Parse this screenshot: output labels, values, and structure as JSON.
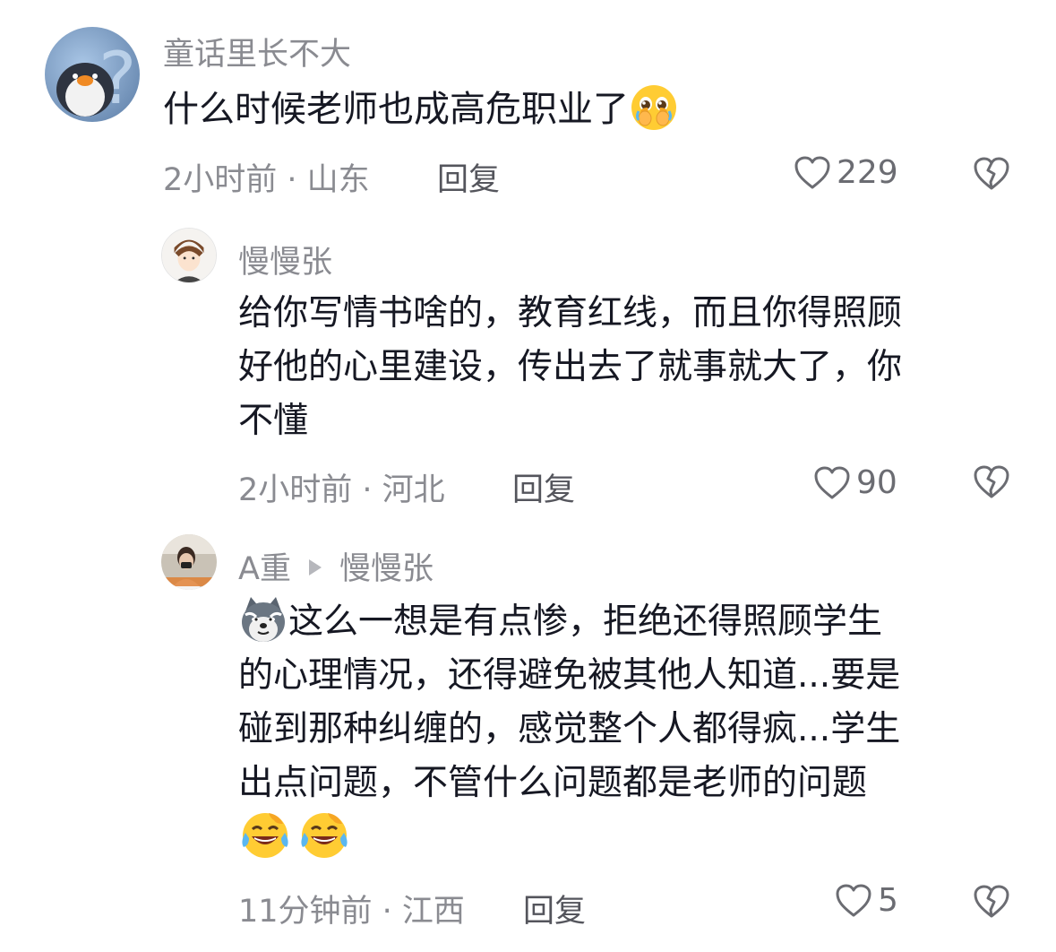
{
  "comments": [
    {
      "username": "童话里长不大",
      "text": "什么时候老师也成高危职业了",
      "emoji": "pleading-face-emoji",
      "time_location": "2小时前 · 山东",
      "reply_label": "回复",
      "likes": "229"
    },
    {
      "username": "慢慢张",
      "lines": [
        "给你写情书啥的，教育红线，而且你得照顾",
        "好他的心里建设，传出去了就事就大了，你",
        "不懂"
      ],
      "time_location": "2小时前 · 河北",
      "reply_label": "回复",
      "likes": "90"
    },
    {
      "username": "A重",
      "reply_to": "慢慢张",
      "lead_emoji": "dog-face-emoji",
      "lines": [
        "这么一想是有点惨，拒绝还得照顾学生",
        "的心理情况，还得避免被其他人知道...要是",
        "碰到那种纠缠的，感觉整个人都得疯...学生",
        "出点问题，不管什么问题都是老师的问题"
      ],
      "trail_emojis": [
        "laughing-crying-emoji",
        "laughing-crying-emoji"
      ],
      "time_location": "11分钟前 · 江西",
      "reply_label": "回复",
      "likes": "5"
    }
  ],
  "colors": {
    "username": "#8a8b91",
    "text": "#161823",
    "meta": "#8a8b91",
    "reply": "#54555c",
    "icon": "#6b6c72"
  }
}
